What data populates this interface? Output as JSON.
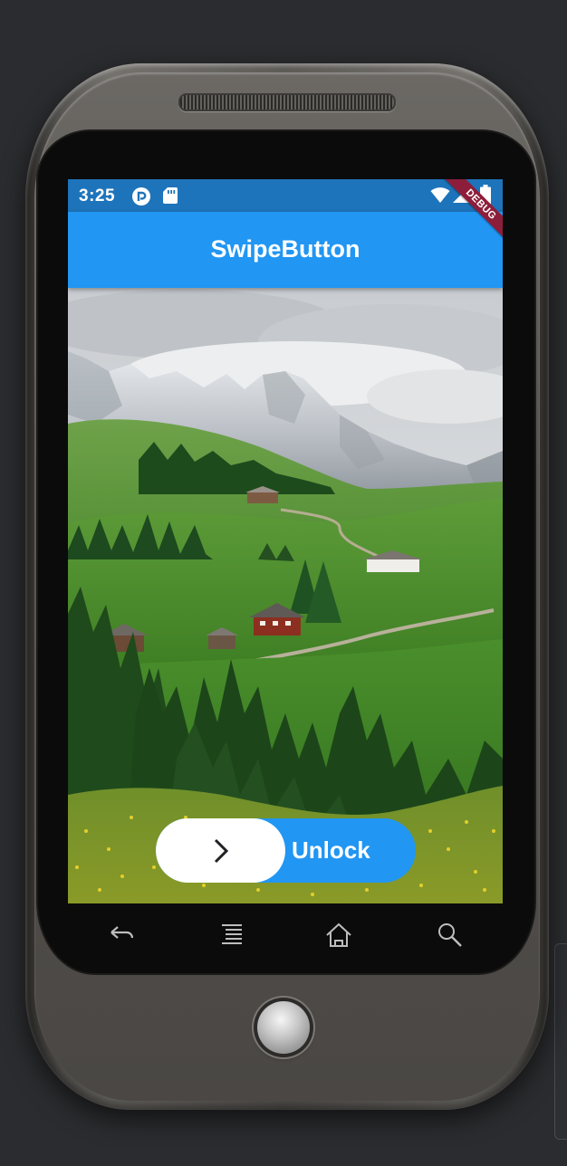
{
  "status_bar": {
    "time": "3:25",
    "icons": [
      "pocket-casts-icon",
      "sd-card-icon",
      "wifi-icon",
      "cell-signal-icon",
      "battery-icon"
    ]
  },
  "app_bar": {
    "title": "SwipeButton"
  },
  "debug_banner": {
    "label": "DEBUG"
  },
  "background_image": {
    "subject": "alpine-meadow-with-mountains"
  },
  "swipe_button": {
    "label": "Unlock",
    "knob_icon": "chevron-right-icon",
    "progress": 0
  },
  "nav_keys": [
    "back-icon",
    "menu-icon",
    "home-icon",
    "search-icon"
  ],
  "colors": {
    "primary": "#2196f3",
    "status_bar": "#1e74ba",
    "debug": "#8d1e3b",
    "knob": "#ffffff"
  }
}
